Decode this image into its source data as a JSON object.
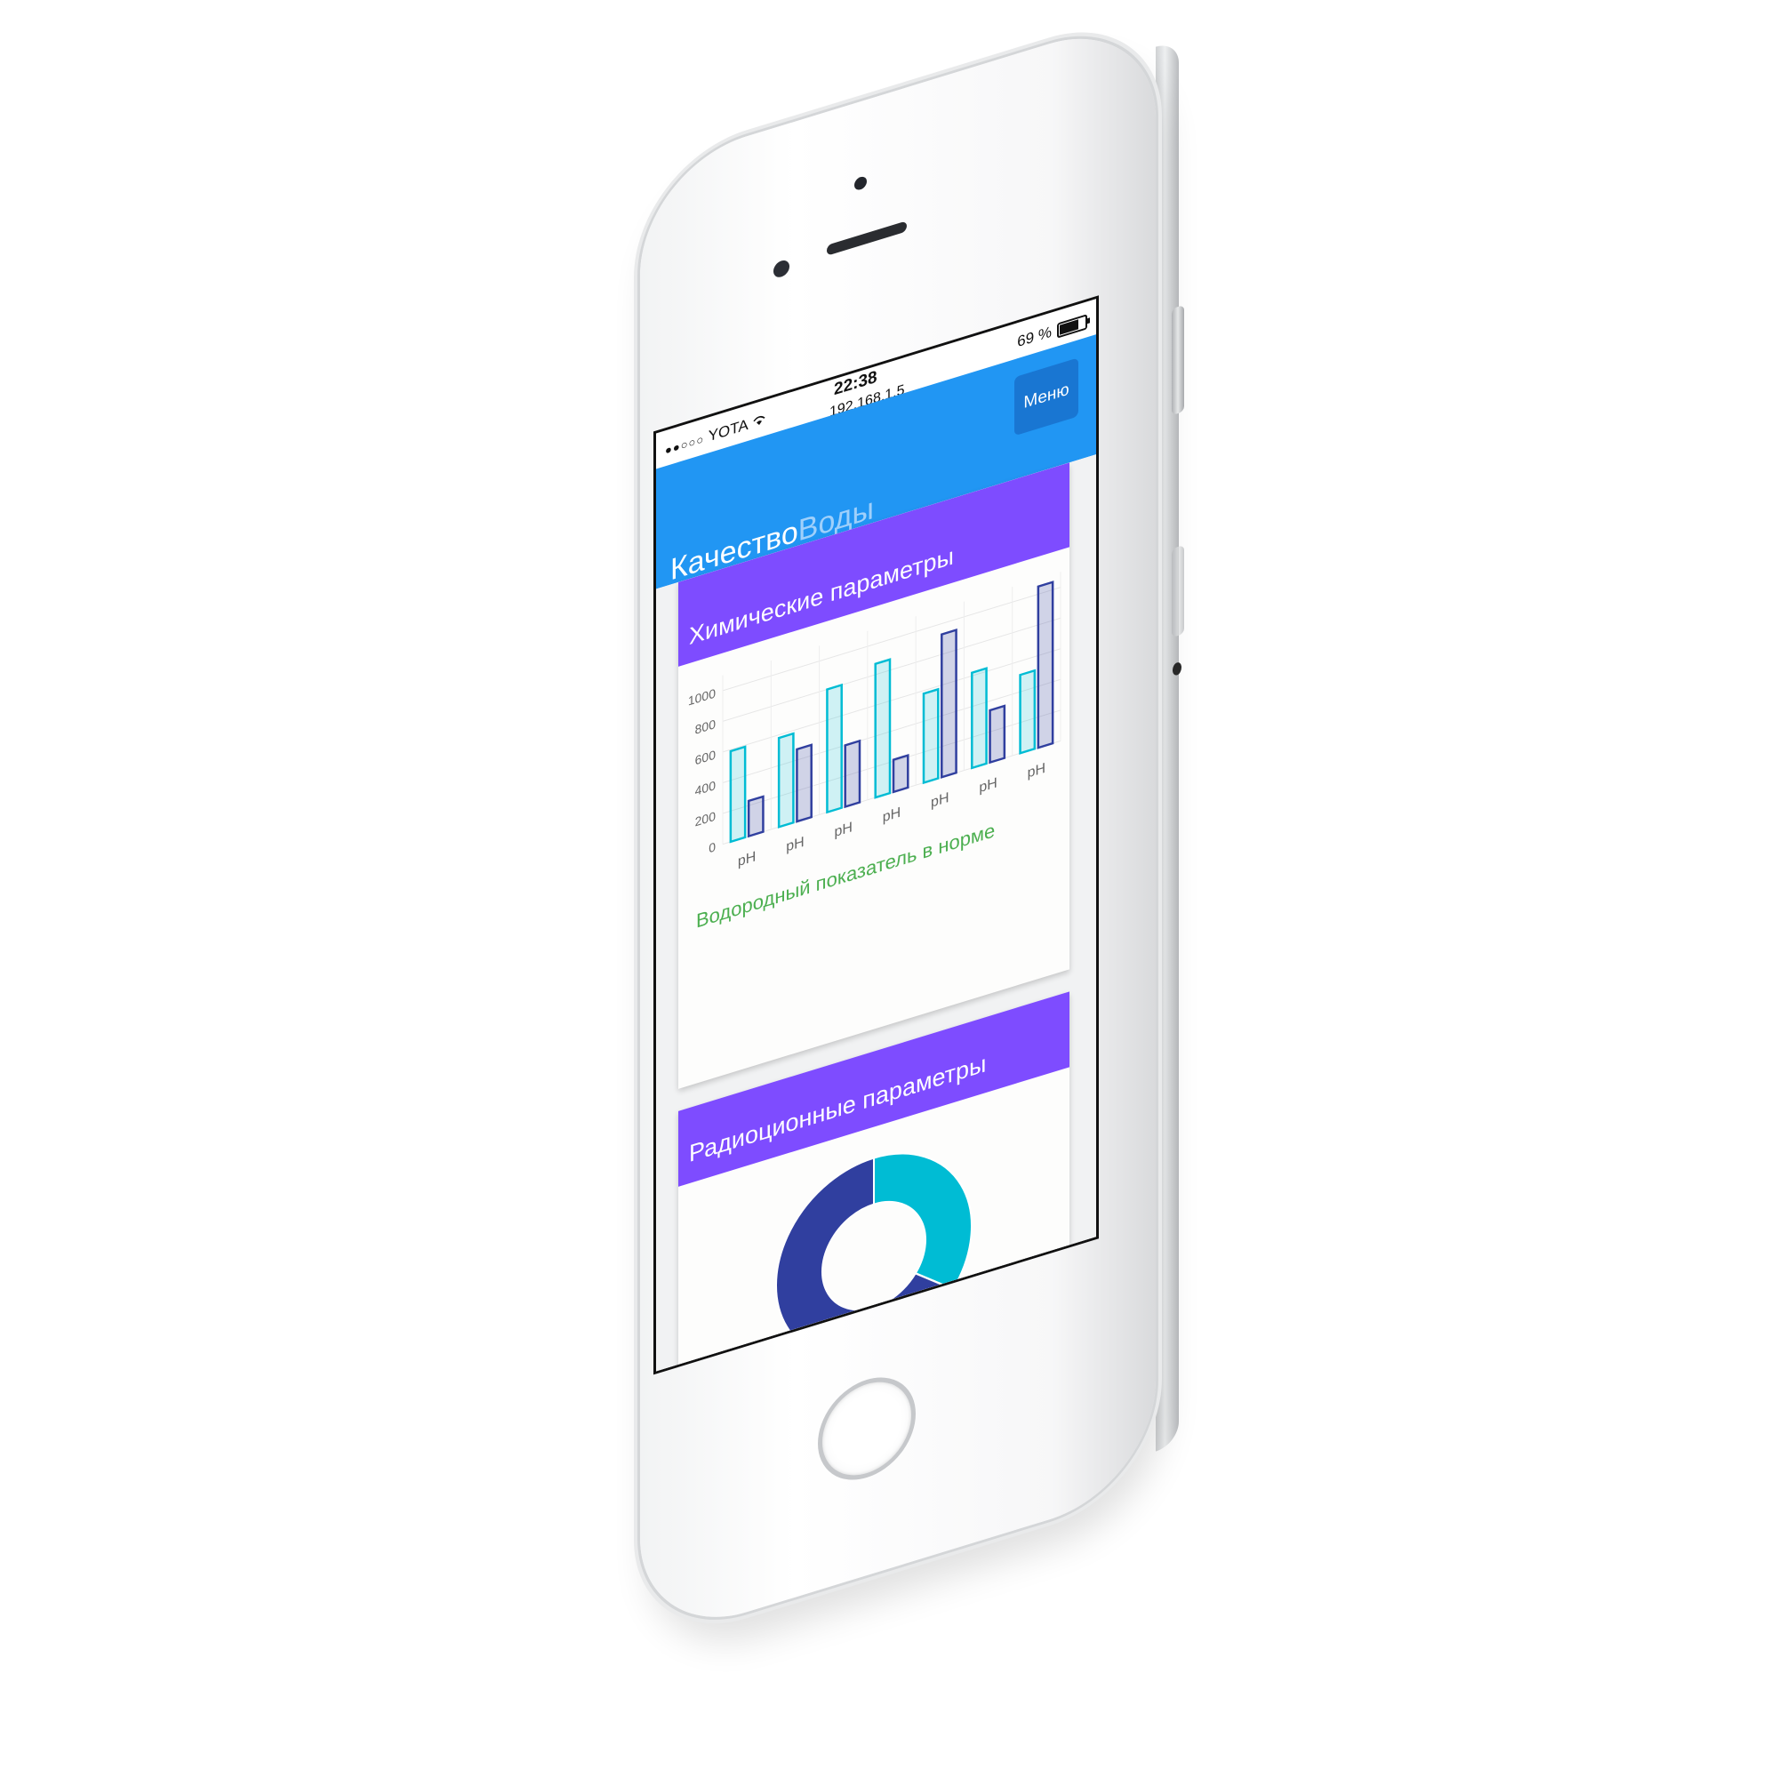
{
  "statusbar": {
    "carrier": "YOTA",
    "time": "22:38",
    "url": "192.168.1.5",
    "battery_text": "69 %",
    "battery_level": 0.69
  },
  "header": {
    "brand_bold": "Качество",
    "brand_light": "Воды",
    "menu_label": "Меню"
  },
  "cards": {
    "chemical_title": "Химические параметры",
    "chemical_status": "Водородный показатель в норме",
    "radiation_title": "Радиоционные параметры"
  },
  "colors": {
    "topbar": "#2196f3",
    "card_header": "#7e4cff",
    "series_cyan": "#00bcd4",
    "series_indigo": "#303f9f",
    "status_ok": "#4caf50"
  },
  "chart_data": [
    {
      "type": "bar",
      "categories": [
        "pH",
        "pH",
        "pH",
        "pH",
        "pH",
        "pH",
        "pH"
      ],
      "series": [
        {
          "values": [
            590,
            580,
            800,
            870,
            580,
            620,
            510
          ]
        },
        {
          "values": [
            230,
            470,
            400,
            210,
            930,
            340,
            1050
          ]
        }
      ],
      "yticks": [
        0,
        200,
        400,
        600,
        800,
        1000
      ],
      "ylim": [
        0,
        1100
      ],
      "grid": true
    },
    {
      "type": "pie",
      "variant": "donut",
      "slices": [
        {
          "value": 35
        },
        {
          "value": 65
        }
      ]
    }
  ]
}
